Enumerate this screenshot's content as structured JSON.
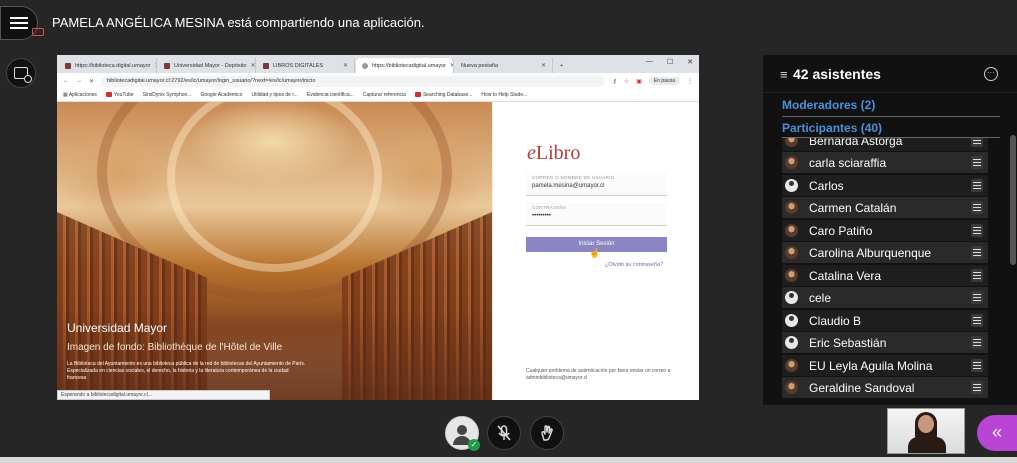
{
  "session": {
    "share_title": "PAMELA ANGÉLICA MESINA está compartiendo una aplicación."
  },
  "browser": {
    "tabs": [
      {
        "label": "https://biblioteca.digital.umayor",
        "active": false
      },
      {
        "label": "Universidad Mayor - Depósito",
        "active": false
      },
      {
        "label": "LIBROS DIGITALES",
        "active": false
      },
      {
        "label": "https://bibliotecadigital.umayor",
        "active": true
      },
      {
        "label": "Nueva pestaña",
        "active": false
      }
    ],
    "url": "bibliotecadigital.umayor.cl:2792/es/lc/umayor/login_usuario/?next=/es/lc/umayor/inicio",
    "pause_label": "En pausa",
    "bookmarks": [
      "Aplicaciones",
      "YouTube",
      "SirsiDynix Symphon...",
      "Google Académico",
      "Utilidad y tipos de r...",
      "Evidencia científica...",
      "Capturar referencia",
      "Searching Database...",
      "How to Help Stude..."
    ],
    "status_text": "Esperando a bibliotecadigital.umayor.cl..."
  },
  "hero": {
    "title": "Universidad Mayor",
    "subtitle": "Imagen de fondo: Bibliothèque de l'Hôtel de Ville",
    "description": "La Biblioteca del Ayuntamiento es una biblioteca pública de la red de bibliotecas del Ayuntamiento de París. Especializada en ciencias sociales, el derecho, la historia y la literatura contemporánea de la ciudad francesa"
  },
  "login": {
    "logo_e": "e",
    "logo_rest": "Libro",
    "user_label": "CORREO O NOMBRE DE USUARIO",
    "user_value": "pamela.mesina@umayor.cl",
    "pass_label": "CONTRASEÑA",
    "pass_value": "•••••••••",
    "submit_label": "Iniciar Sesión",
    "forgot_label": "¿Olvidó su contraseña?",
    "help_text": "Cualquier problema de autenticación por favor enviar un correo a adminbiblioteca@umayor.cl"
  },
  "panel": {
    "attendees_label": "42 asistentes",
    "moderators_label": "Moderadores (2)",
    "participants_label": "Participantes (40)",
    "participants": [
      {
        "name": "Bernarda Astorga",
        "avatar": "photo"
      },
      {
        "name": "carla sciaraffia",
        "avatar": "photo"
      },
      {
        "name": "Carlos",
        "avatar": "user"
      },
      {
        "name": "Carmen Catalán",
        "avatar": "photo"
      },
      {
        "name": "Caro Patiño",
        "avatar": "photo"
      },
      {
        "name": "Carolina Alburquenque",
        "avatar": "photo"
      },
      {
        "name": "Catalina Vera",
        "avatar": "photo"
      },
      {
        "name": "cele",
        "avatar": "user"
      },
      {
        "name": "Claudio B",
        "avatar": "user"
      },
      {
        "name": "Eric Sebastián",
        "avatar": "user"
      },
      {
        "name": "EU Leyla Aguila Molina",
        "avatar": "photo"
      },
      {
        "name": "Geraldine Sandoval",
        "avatar": "photo"
      }
    ]
  },
  "icons": {
    "menu": "hamburger-icon",
    "screen_share": "screen-share-icon",
    "more": "more-options-icon",
    "mic_muted": "mic-muted-icon",
    "raise_hand": "raise-hand-icon",
    "collapse": "double-chevron-left-icon"
  },
  "colors": {
    "accent_purple": "#b845d6",
    "section_blue": "#4a90d9",
    "login_button": "#8a86c4",
    "elibro_red": "#b23b3b",
    "status_green": "#1e9e4a"
  }
}
